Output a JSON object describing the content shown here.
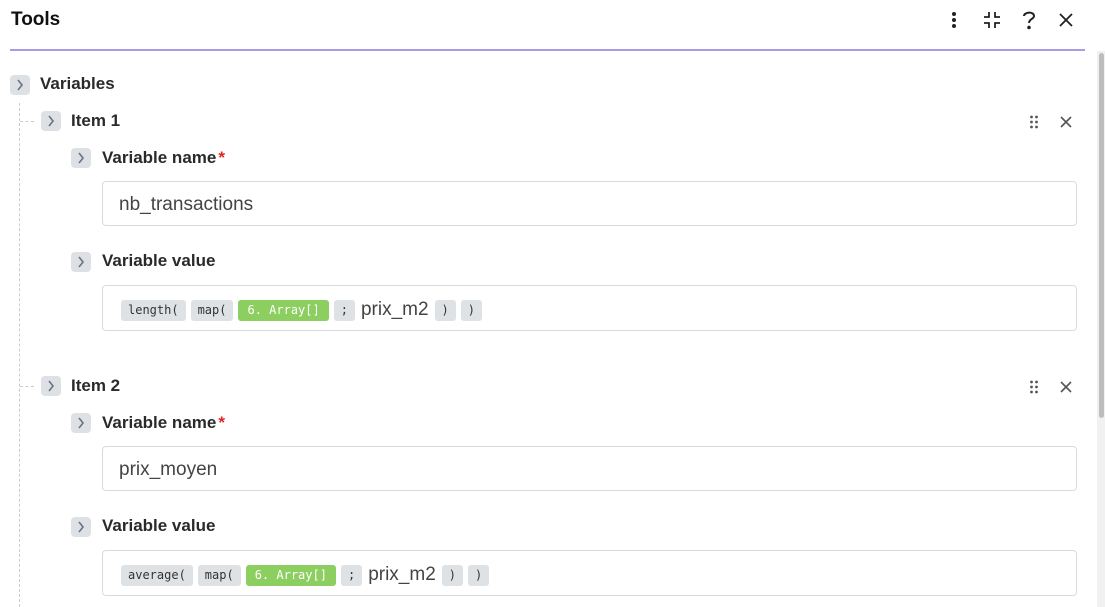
{
  "header": {
    "title": "Tools",
    "accent": "#a59de6"
  },
  "variables": {
    "label": "Variables",
    "items": [
      {
        "title": "Item 1",
        "name_label": "Variable name",
        "required_mark": "*",
        "name_value": "nb_transactions",
        "value_label": "Variable value",
        "value_tokens": {
          "fn1": "length(",
          "fn2": "map(",
          "source": "6. Array[]",
          "sep": ";",
          "field": "prix_m2",
          "close1": ")",
          "close2": ")"
        }
      },
      {
        "title": "Item 2",
        "name_label": "Variable name",
        "required_mark": "*",
        "name_value": "prix_moyen",
        "value_label": "Variable value",
        "value_tokens": {
          "fn1": "average(",
          "fn2": "map(",
          "source": "6. Array[]",
          "sep": ";",
          "field": "prix_m2",
          "close1": ")",
          "close2": ")"
        }
      }
    ]
  },
  "colors": {
    "source_token": "#8ccf60",
    "required": "#e02424"
  },
  "icons": {
    "more": "more-vertical-icon",
    "collapse": "collapse-icon",
    "help": "help-icon",
    "close": "close-icon",
    "drag": "drag-handle-icon",
    "remove": "remove-item-icon",
    "chevron": "chevron-right-icon"
  }
}
